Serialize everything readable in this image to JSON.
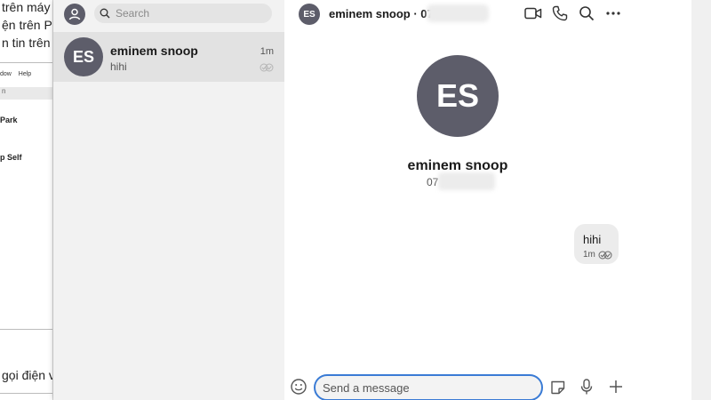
{
  "background_page": {
    "line1": "trên máy",
    "line2": "ện trên PC",
    "line3": "n tin trên S",
    "menu": [
      "dow",
      "Help"
    ],
    "highlight_text": "n",
    "item1": "Park",
    "item2": "p Self",
    "call_text": "gọi điện vi"
  },
  "sidebar": {
    "search_placeholder": "Search",
    "conversation": {
      "initials": "ES",
      "name": "eminem snoop",
      "preview": "hihi",
      "time": "1m"
    }
  },
  "chat": {
    "header": {
      "initials": "ES",
      "title": "eminem snoop · 0767"
    },
    "profile": {
      "initials": "ES",
      "name": "eminem snoop",
      "phone_prefix": "07"
    },
    "message": {
      "text": "hihi",
      "time": "1m"
    },
    "composer": {
      "placeholder": "Send a message"
    }
  },
  "colors": {
    "avatar": "#5d5d6a",
    "accent": "#3a7bd5",
    "sidebar_bg": "#f2f2f2",
    "selected_bg": "#e2e2e2"
  },
  "icons": [
    "profile-icon",
    "search-icon",
    "seen-check-icon",
    "video-call-icon",
    "phone-call-icon",
    "chat-search-icon",
    "more-icon",
    "emoji-icon",
    "sticker-icon",
    "microphone-icon",
    "plus-icon"
  ]
}
